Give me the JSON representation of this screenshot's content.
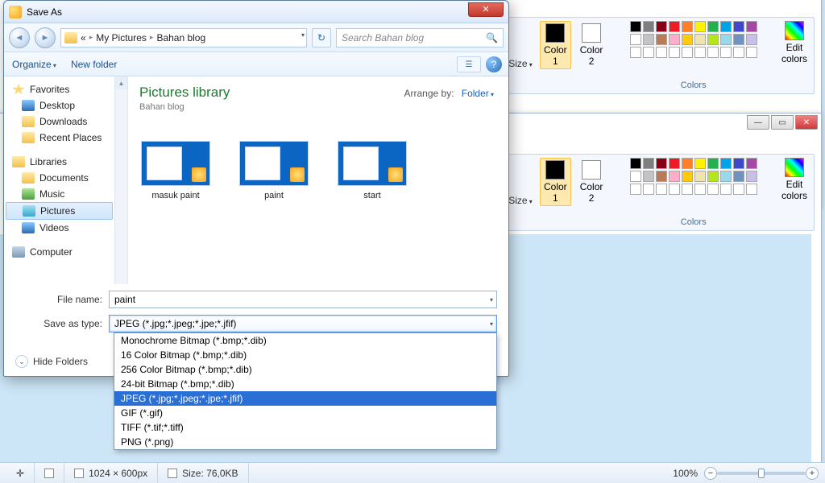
{
  "bg_windows": {
    "controls": {
      "min": "—",
      "max": "▭",
      "close": "✕"
    }
  },
  "ribbon": {
    "size_label": "Size",
    "color1_label": "Color\n1",
    "color2_label": "Color\n2",
    "group_label": "Colors",
    "edit_colors": "Edit\ncolors",
    "palette_top": [
      "#000000",
      "#7f7f7f",
      "#880015",
      "#ed1c24",
      "#ff7f27",
      "#fff200",
      "#22b14c",
      "#00a2e8",
      "#3f48cc",
      "#a349a4"
    ],
    "palette_bot": [
      "#ffffff",
      "#c3c3c3",
      "#b97a57",
      "#ffaec9",
      "#ffc90e",
      "#efe4b0",
      "#b5e61d",
      "#99d9ea",
      "#7092be",
      "#c8bfe7"
    ],
    "palette_empty_count": 10,
    "color1_value": "#000000",
    "color2_value": "#ffffff"
  },
  "status": {
    "dims": "1024 × 600px",
    "size": "Size: 76,0KB",
    "zoom": "100%",
    "minus": "−",
    "plus": "+"
  },
  "dialog": {
    "title": "Save As",
    "close_x": "✕",
    "nav_back": "◄",
    "nav_fwd": "►",
    "breadcrumb": [
      "«",
      "My Pictures",
      "Bahan blog"
    ],
    "refresh": "↻",
    "search_placeholder": "Search Bahan blog",
    "search_icon": "🔍",
    "organize": "Organize",
    "new_folder": "New folder",
    "view_icon1": "☰",
    "help_icon": "?",
    "sidebar": {
      "favorites": "Favorites",
      "desktop": "Desktop",
      "downloads": "Downloads",
      "recent": "Recent Places",
      "libraries": "Libraries",
      "documents": "Documents",
      "music": "Music",
      "pictures": "Pictures",
      "videos": "Videos",
      "computer": "Computer"
    },
    "library_title": "Pictures library",
    "library_sub": "Bahan blog",
    "arrange_label": "Arrange by:",
    "arrange_value": "Folder",
    "thumbs": [
      "masuk paint",
      "paint",
      "start"
    ],
    "filename_label": "File name:",
    "filename_value": "paint",
    "type_label": "Save as type:",
    "type_value": "JPEG (*.jpg;*.jpeg;*.jpe;*.jfif)",
    "hide_folders": "Hide Folders",
    "chev": "⌄",
    "type_options": [
      "Monochrome Bitmap (*.bmp;*.dib)",
      "16 Color Bitmap (*.bmp;*.dib)",
      "256 Color Bitmap (*.bmp;*.dib)",
      "24-bit Bitmap (*.bmp;*.dib)",
      "JPEG (*.jpg;*.jpeg;*.jpe;*.jfif)",
      "GIF (*.gif)",
      "TIFF (*.tif;*.tiff)",
      "PNG (*.png)"
    ],
    "type_selected_index": 4
  }
}
